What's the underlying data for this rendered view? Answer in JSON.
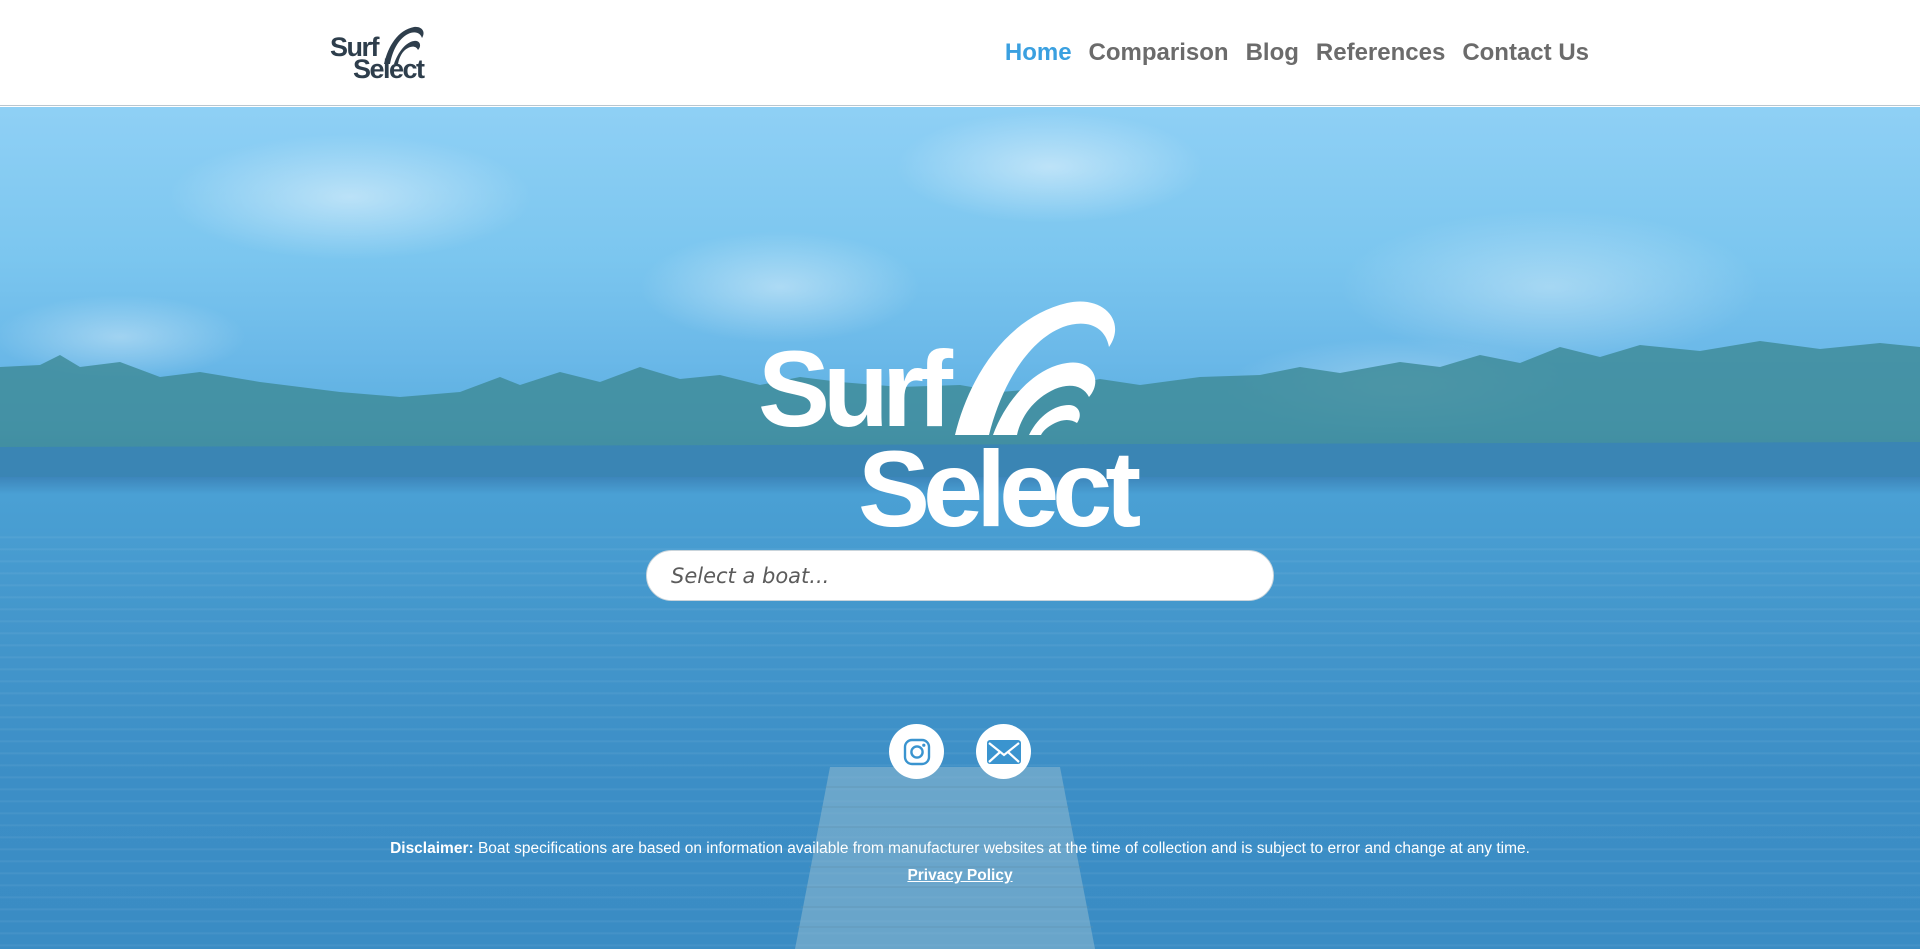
{
  "brand": {
    "logo_line1": "Surf",
    "logo_line2": "Select"
  },
  "nav": {
    "items": [
      {
        "label": "Home",
        "active": true
      },
      {
        "label": "Comparison",
        "active": false
      },
      {
        "label": "Blog",
        "active": false
      },
      {
        "label": "References",
        "active": false
      },
      {
        "label": "Contact Us",
        "active": false
      }
    ]
  },
  "hero": {
    "logo_line1": "Surf",
    "logo_line2": "Select",
    "search_placeholder": "Select a boat...",
    "social": [
      {
        "icon": "instagram-icon"
      },
      {
        "icon": "email-icon"
      }
    ]
  },
  "footer": {
    "disclaimer_label": "Disclaimer:",
    "disclaimer_text": " Boat specifications are based on information available from manufacturer websites at the time of collection and is subject to error and change at any time.",
    "privacy_label": "Privacy Policy"
  },
  "colors": {
    "accent": "#3aa0e0",
    "nav_text": "#6b6b6b",
    "logo_dark": "#2e3e4c",
    "hero_overlay": "#4aa0d4"
  }
}
